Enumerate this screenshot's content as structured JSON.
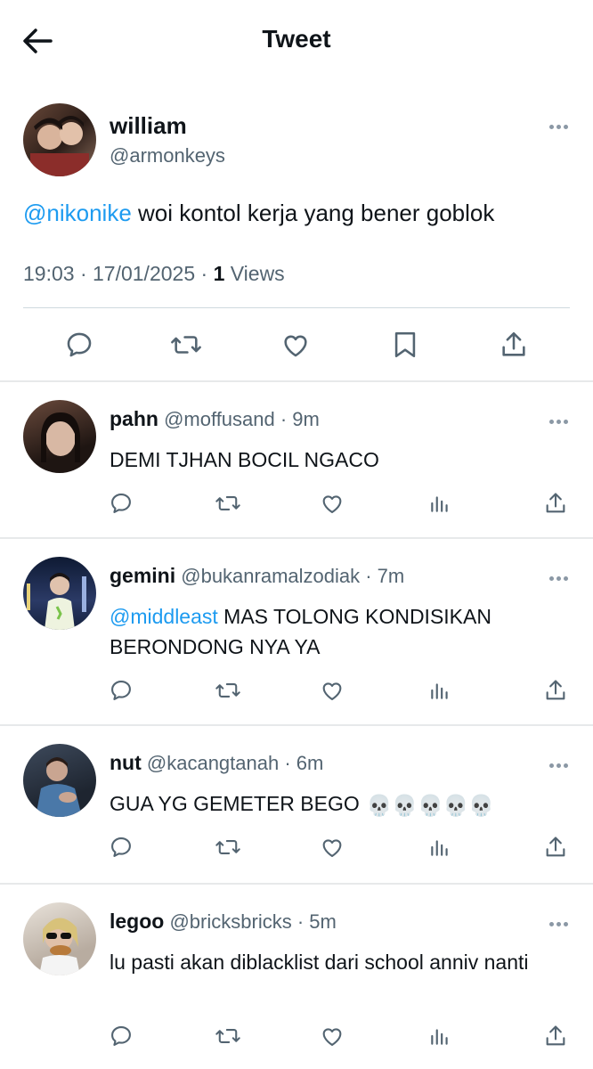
{
  "header": {
    "title": "Tweet",
    "back_icon": "arrow-left-icon"
  },
  "main_tweet": {
    "name": "william",
    "handle": "@armonkeys",
    "mention": "@nikonike",
    "text": " woi kontol kerja yang bener goblok",
    "meta_prefix": "19:03 · 17/01/2025 · ",
    "views_count": "1",
    "views_label": " Views",
    "actions": [
      "reply-icon",
      "retweet-icon",
      "like-icon",
      "bookmark-icon",
      "share-icon"
    ]
  },
  "replies": [
    {
      "name": "pahn",
      "handle": "@moffusand · 9m",
      "mention": "",
      "text": "DEMI TJHAN BOCIL NGACO",
      "avatar_color": "#3a2a24"
    },
    {
      "name": "gemini",
      "handle": "@bukanramalzodiak · 7m",
      "mention": "@middleast",
      "text": " MAS TOLONG KONDISIKAN BERONDONG NYA YA",
      "avatar_color": "#1f2a44"
    },
    {
      "name": "nut",
      "handle": "@kacangtanah · 6m",
      "mention": "",
      "text": "GUA YG GEMETER BEGO",
      "emoji": "💀💀💀💀💀",
      "avatar_color": "#2e3a4a"
    },
    {
      "name": "legoo",
      "handle": "@bricksbricks · 5m",
      "mention": "",
      "text": "lu pasti akan diblacklist dari school anniv nanti",
      "avatar_color": "#c9bfb4"
    }
  ],
  "reply_actions": [
    "reply-icon",
    "retweet-icon",
    "like-icon",
    "views-icon",
    "share-icon"
  ],
  "colors": {
    "accent": "#1d9bf0",
    "muted": "#536471",
    "icon": "#536471"
  }
}
